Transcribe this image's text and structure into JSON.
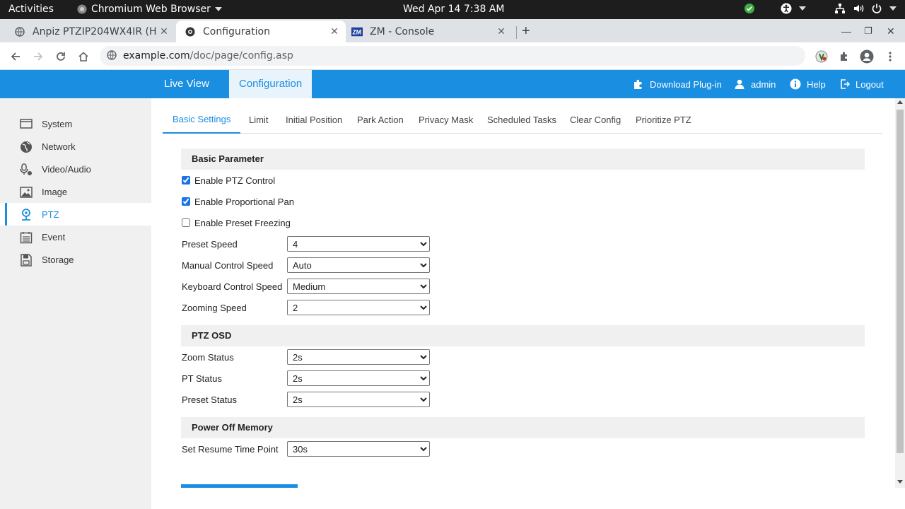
{
  "os": {
    "activities": "Activities",
    "app_name": "Chromium Web Browser",
    "clock": "Wed Apr 14  7:38 AM"
  },
  "browser": {
    "tabs": [
      {
        "title": "Anpiz PTZIP204WX4IR (Hi"
      },
      {
        "title": "Configuration"
      },
      {
        "title": "ZM - Console"
      }
    ],
    "url_host": "example.com",
    "url_path": "/doc/page/config.asp"
  },
  "header": {
    "nav": [
      "Live View",
      "Configuration"
    ],
    "download_plugin": "Download Plug-in",
    "user": "admin",
    "help": "Help",
    "logout": "Logout"
  },
  "sidebar": {
    "items": [
      {
        "label": "System",
        "icon": "monitor-icon"
      },
      {
        "label": "Network",
        "icon": "globe-icon"
      },
      {
        "label": "Video/Audio",
        "icon": "video-audio-icon"
      },
      {
        "label": "Image",
        "icon": "image-icon"
      },
      {
        "label": "PTZ",
        "icon": "ptz-icon"
      },
      {
        "label": "Event",
        "icon": "event-icon"
      },
      {
        "label": "Storage",
        "icon": "storage-icon"
      }
    ],
    "active_index": 4
  },
  "subtabs": [
    "Basic Settings",
    "Limit",
    "Initial Position",
    "Park Action",
    "Privacy Mask",
    "Scheduled Tasks",
    "Clear Config",
    "Prioritize PTZ"
  ],
  "basic_parameter": {
    "title": "Basic Parameter",
    "enable_ptz_control": {
      "label": "Enable PTZ Control",
      "checked": true
    },
    "enable_proportional_pan": {
      "label": "Enable Proportional Pan",
      "checked": true
    },
    "enable_preset_freezing": {
      "label": "Enable Preset Freezing",
      "checked": false
    },
    "preset_speed": {
      "label": "Preset Speed",
      "value": "4"
    },
    "manual_control_speed": {
      "label": "Manual Control Speed",
      "value": "Auto"
    },
    "keyboard_control_speed": {
      "label": "Keyboard Control Speed",
      "value": "Medium"
    },
    "zooming_speed": {
      "label": "Zooming Speed",
      "value": "2"
    }
  },
  "ptz_osd": {
    "title": "PTZ OSD",
    "zoom_status": {
      "label": "Zoom Status",
      "value": "2s"
    },
    "pt_status": {
      "label": "PT Status",
      "value": "2s"
    },
    "preset_status": {
      "label": "Preset Status",
      "value": "2s"
    }
  },
  "power_off_memory": {
    "title": "Power Off Memory",
    "set_resume_time_point": {
      "label": "Set Resume Time Point",
      "value": "30s"
    }
  },
  "colors": {
    "accent": "#1a8ee0",
    "sidebar_bg": "#f0f0f0",
    "section_bg": "#f0f0f0"
  }
}
